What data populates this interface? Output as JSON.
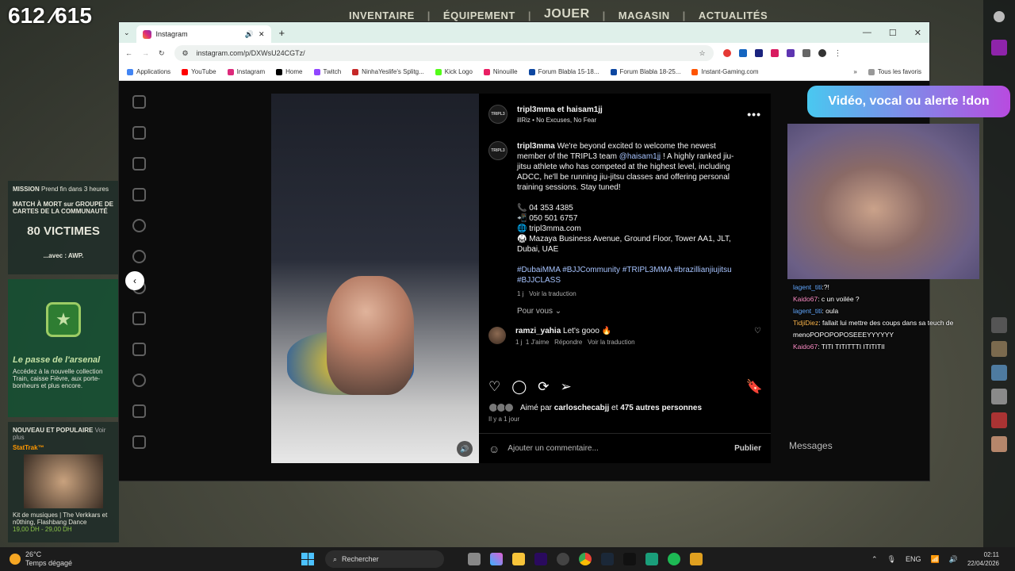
{
  "game": {
    "score": "612 ⁄615",
    "nav": [
      "INVENTAIRE",
      "ÉQUIPEMENT",
      "JOUER",
      "MAGASIN",
      "ACTUALITÉS"
    ],
    "mission_title": "MISSION",
    "mission_time": "Prend fin dans 3 heures",
    "mission_desc": "MATCH À MORT sur GROUPE DE CARTES DE LA COMMUNAUTÉ",
    "mission_kills": "80 VICTIMES",
    "mission_weapon": "...avec : AWP.",
    "pass_title": "Le passe de l'arsenal",
    "pass_desc": "Accédez à la nouvelle collection Train, caisse Fièvre, aux porte-bonheurs et plus encore.",
    "popular_title": "NOUVEAU ET POPULAIRE",
    "popular_more": "Voir plus",
    "stattrak": "StatTrak™",
    "music_kit": "Kit de musiques | The Verkkars et n0thing, Flashbang Dance",
    "music_price": "19,00 DH - 29,00 DH"
  },
  "browser": {
    "tab_title": "Instagram",
    "url": "instagram.com/p/DXWsU24CGTz/",
    "new_tab": "+",
    "window_controls": [
      "—",
      "☐",
      "✕"
    ],
    "bookmarks": [
      {
        "label": "Applications",
        "color": "#4285f4"
      },
      {
        "label": "YouTube",
        "color": "#ff0000"
      },
      {
        "label": "Instagram",
        "color": "#dd2a7b"
      },
      {
        "label": "Home",
        "color": "#000000"
      },
      {
        "label": "Twitch",
        "color": "#9146ff"
      },
      {
        "label": "NinhaYeslife's Splitg...",
        "color": "#c62828"
      },
      {
        "label": "Kick Logo",
        "color": "#53fc18"
      },
      {
        "label": "Ninouille",
        "color": "#e91e63"
      },
      {
        "label": "Forum Blabla 15-18...",
        "color": "#0d47a1"
      },
      {
        "label": "Forum Blabla 18-25...",
        "color": "#0d47a1"
      },
      {
        "label": "Instant-Gaming.com",
        "color": "#ff5400"
      }
    ],
    "bookmarks_more": "»",
    "all_favorites": "Tous les favoris"
  },
  "post": {
    "header_names": "tripl3mma et haisam1jj",
    "header_sub": "illRiz • No Excuses, No Fear",
    "avatar_label": "TRIPL3",
    "caption_user": "tripl3mma",
    "caption_text_1": " We're beyond excited to welcome the newest member of the TRIPL3 team ",
    "caption_mention": "@haisam1jj",
    "caption_text_2": " ! A highly ranked jiu-jitsu athlete who has competed at the highest level, including ADCC, he'll be running jiu-jitsu classes and offering personal training sessions. Stay tuned!",
    "phone1": "📞 04 353 4385",
    "phone2": "📲 050 501 6757",
    "web": "🌐 tripl3mma.com",
    "address": "🥋 Mazaya Business Avenue, Ground Floor, Tower AA1, JLT, Dubai, UAE",
    "hashtags": "#DubaiMMA #BJJCommunity #TRIPL3MMA #brazillianjiujitsu #BJJCLASS",
    "caption_time": "1 j",
    "see_translation": "Voir la traduction",
    "for_you": "Pour vous",
    "comment_user": "ramzi_yahia",
    "comment_text": "Let's gooo 🔥",
    "comment_time": "1 j",
    "comment_likes": "1 J'aime",
    "comment_reply": "Répondre",
    "comment_translate": "Voir la traduction",
    "liked_by_prefix": "Aimé par ",
    "liked_by_user": "carloschecabjj",
    "liked_by_mid": " et ",
    "liked_by_count": "475 autres personnes",
    "date": "Il y a 1 jour",
    "add_comment": "Ajouter un commentaire...",
    "publish": "Publier"
  },
  "stream": {
    "don_button": "Vidéo, vocal ou alerte !don",
    "chat": [
      {
        "user": "lagent_titi",
        "text": ":?!",
        "cls": "u1"
      },
      {
        "user": "Kaido67",
        "text": ": c un voilée ?",
        "cls": "u2"
      },
      {
        "user": "lagent_titi",
        "text": ": oula",
        "cls": "u1"
      },
      {
        "user": "TidjiDiez",
        "text": ": fallait lui mettre des coups dans sa teuch de menoPOPOPOPOSEEEYYYYYY",
        "cls": "u3"
      },
      {
        "user": "Kaido67",
        "text": ": TITI TITITTTI ITITITII",
        "cls": "u2"
      }
    ],
    "messages_label": "Messages"
  },
  "taskbar": {
    "temp": "26°C",
    "weather": "Temps dégagé",
    "search": "Rechercher",
    "lang": "ENG",
    "time": "02:11",
    "date": "22/04/2026"
  }
}
